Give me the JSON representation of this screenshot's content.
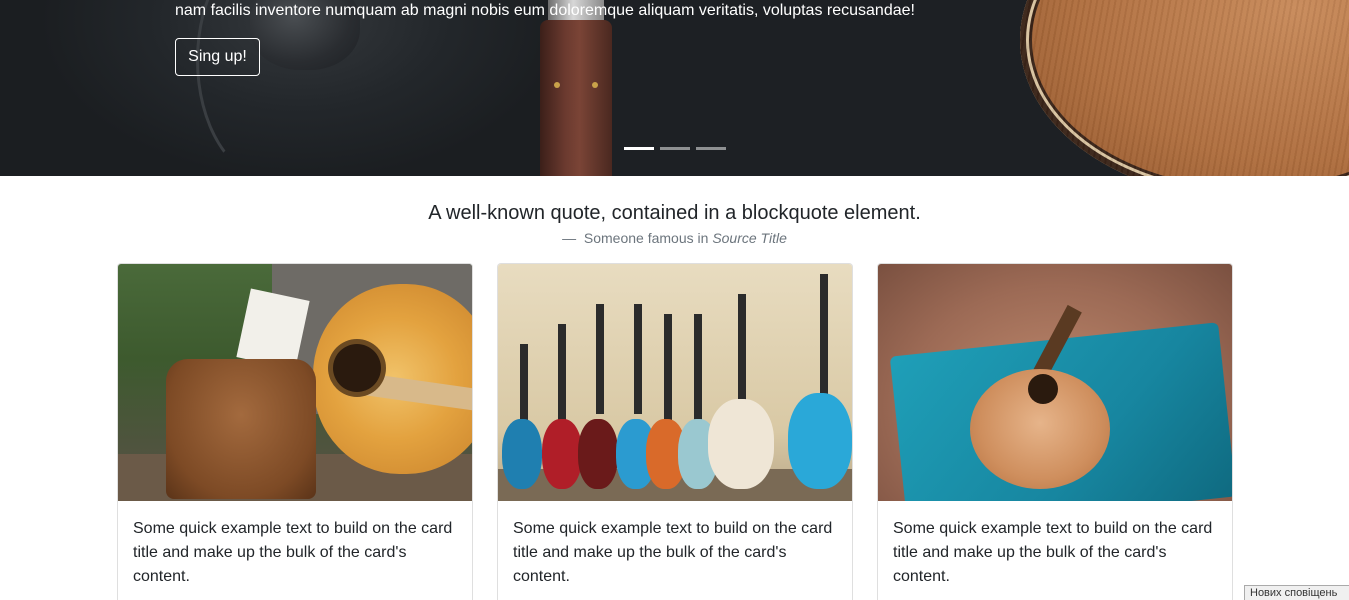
{
  "hero": {
    "text": "nam facilis inventore numquam ab magni nobis eum doloremque aliquam veritatis, voluptas recusandae!",
    "button_label": "Sing up!",
    "indicators": [
      {
        "active": true
      },
      {
        "active": false
      },
      {
        "active": false
      }
    ]
  },
  "quote": {
    "text": "A well-known quote, contained in a blockquote element.",
    "author": "Someone famous in",
    "source": "Source Title"
  },
  "cards": [
    {
      "text": "Some quick example text to build on the card title and make up the bulk of the card's content."
    },
    {
      "text": "Some quick example text to build on the card title and make up the bulk of the card's content."
    },
    {
      "text": "Some quick example text to build on the card title and make up the bulk of the card's content."
    }
  ],
  "system": {
    "notification": "Нових сповіщень"
  }
}
